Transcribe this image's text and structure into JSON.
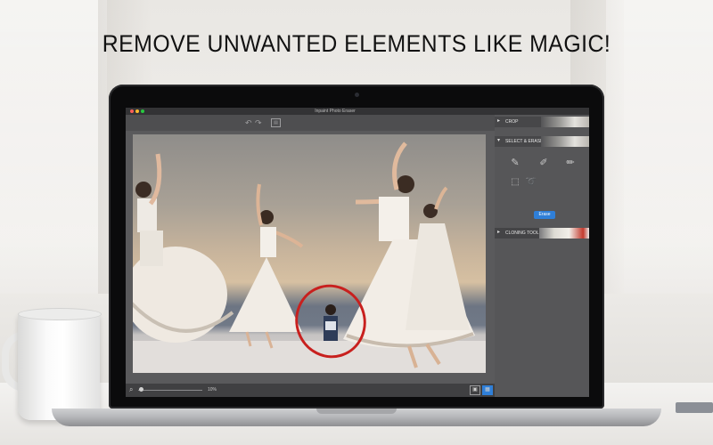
{
  "headline": "REMOVE UNWANTED ELEMENTS LIKE MAGIC!",
  "app": {
    "window_title": "Inpaint Photo Eraser",
    "toolbar": {
      "undo_icon": "undo-icon",
      "redo_icon": "redo-icon",
      "save_icon": "save-icon"
    },
    "panel": {
      "sections": [
        {
          "label": "CROP",
          "arrow": "▸"
        },
        {
          "label": "SELECT & ERASE",
          "arrow": "▾"
        },
        {
          "label": "CLONING TOOL",
          "arrow": "▸"
        }
      ],
      "tools": [
        "brush-icon",
        "pencil-icon",
        "marker-icon",
        "rect-select-icon",
        "lasso-icon"
      ],
      "erase_label": "Erase"
    },
    "statusbar": {
      "zoom_value": "10%",
      "zoom_icon": "magnifier-icon"
    },
    "colors": {
      "accent": "#2f7fd8",
      "selection_ring": "#c8201e",
      "panel_bg": "#565658"
    }
  }
}
